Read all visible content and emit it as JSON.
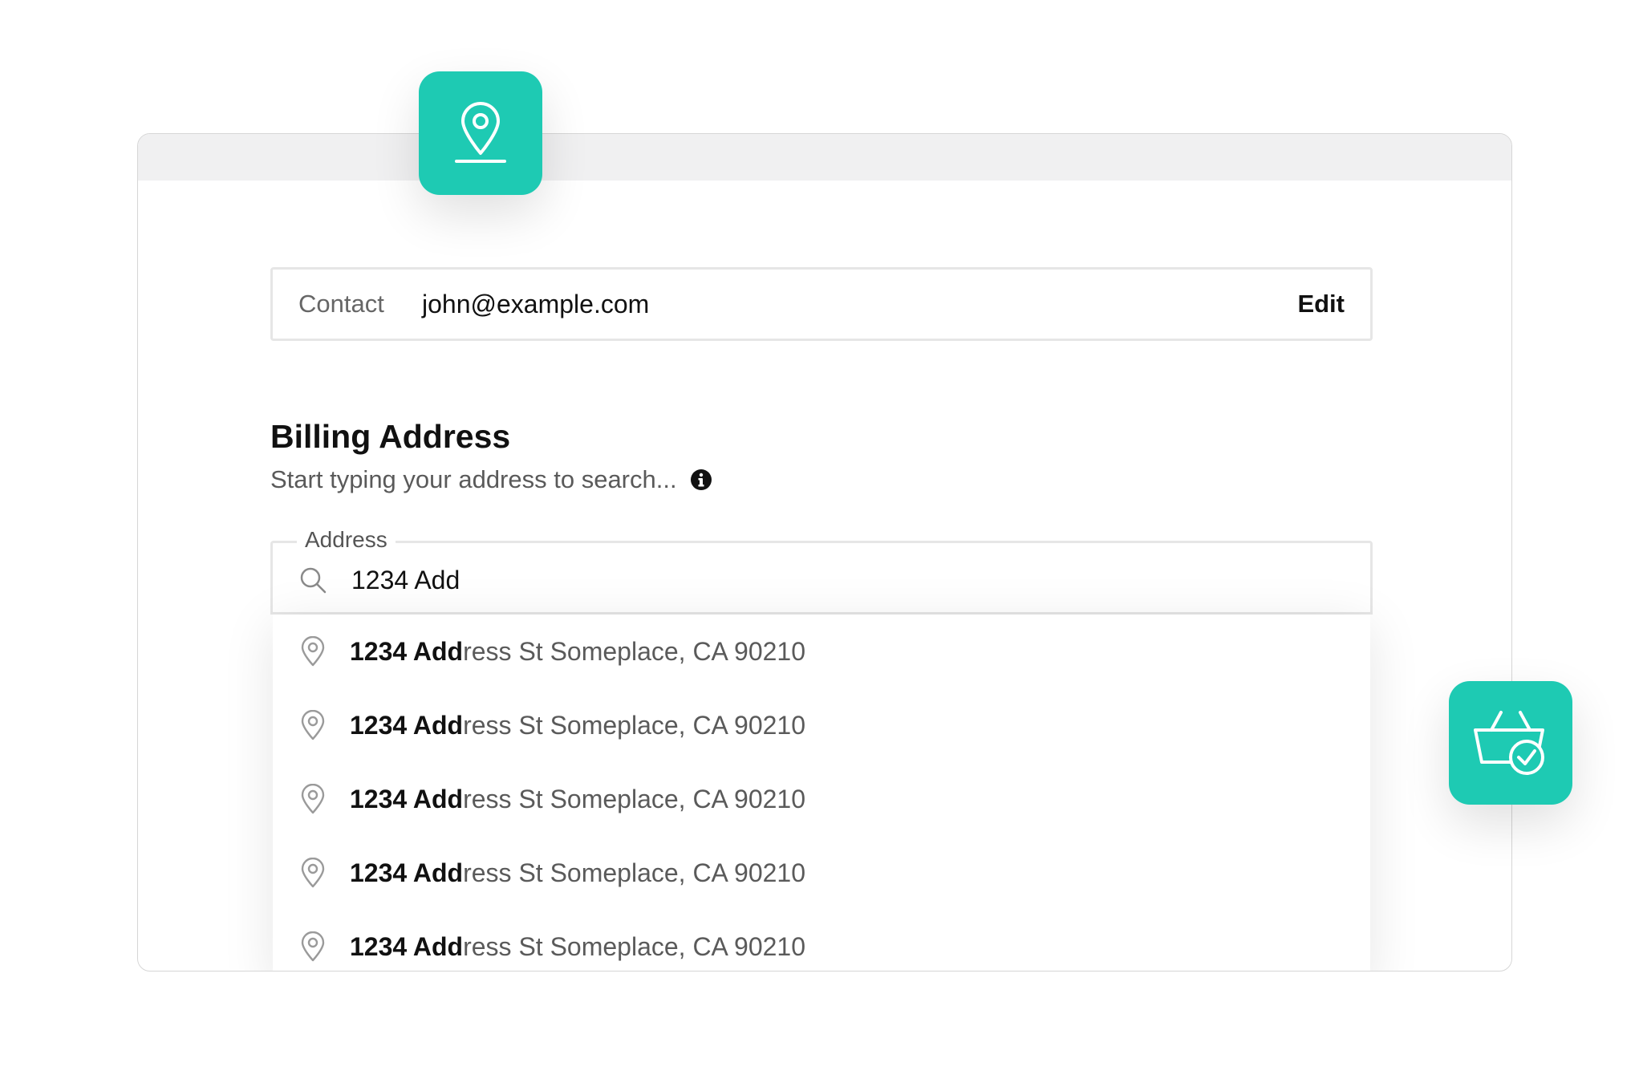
{
  "contact": {
    "label": "Contact",
    "value": "john@example.com",
    "edit_label": "Edit"
  },
  "billing": {
    "title": "Billing Address",
    "subtitle": "Start typing your address to search...",
    "info_icon": "info-icon"
  },
  "address": {
    "legend": "Address",
    "value": "1234 Add",
    "search_icon": "search-icon"
  },
  "suggestions": [
    {
      "match": "1234 Add",
      "rest": "ress St Someplace, CA 90210"
    },
    {
      "match": "1234 Add",
      "rest": "ress St Someplace, CA 90210"
    },
    {
      "match": "1234 Add",
      "rest": "ress St Someplace, CA 90210"
    },
    {
      "match": "1234 Add",
      "rest": "ress St Someplace, CA 90210"
    },
    {
      "match": "1234 Add",
      "rest": "ress St Someplace, CA 90210"
    }
  ],
  "badges": {
    "location_icon": "location-pin-icon",
    "basket_icon": "basket-check-icon"
  },
  "colors": {
    "accent": "#1ecab3",
    "text_primary": "#111111",
    "text_secondary": "#5a5a5a",
    "border": "#e6e6e6",
    "titlebar": "#f0f0f1"
  }
}
